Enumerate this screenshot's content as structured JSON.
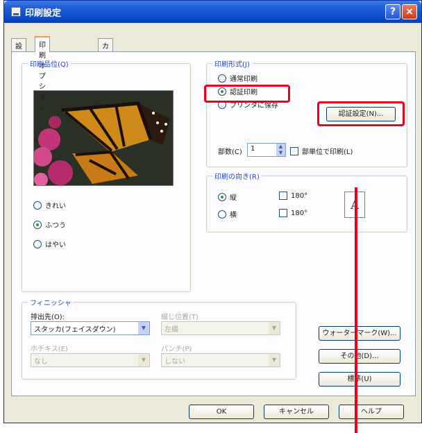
{
  "window": {
    "title": "印刷設定",
    "help_label": "?",
    "close_label": "×"
  },
  "tabs": [
    "設定",
    "印刷オプション",
    "カラー"
  ],
  "print_quality": {
    "label": "印刷品位(Q)",
    "options": [
      {
        "label": "きれい",
        "selected": false
      },
      {
        "label": "ふつう",
        "selected": true
      },
      {
        "label": "はやい",
        "selected": false
      }
    ]
  },
  "print_mode": {
    "label": "印刷形式(J)",
    "options": [
      {
        "label": "通常印刷",
        "selected": false
      },
      {
        "label": "認証印刷",
        "selected": true
      },
      {
        "label": "プリンタに保存",
        "selected": false
      }
    ],
    "auth_settings_button": "認証設定(N)...",
    "copies_label": "部数(C)",
    "copies_value": "1",
    "collate_label": "部単位で印刷(L)",
    "collate_checked": false
  },
  "orientation": {
    "label": "印刷の向き(R)",
    "portrait_label": "縦",
    "landscape_label": "横",
    "rotate_label": "180°",
    "selected": "portrait",
    "preview_glyph": "A"
  },
  "finisher": {
    "label": "フィニッシャ",
    "output_label": "排出先(O):",
    "output_value": "スタッカ(フェイスダウン)",
    "binding_label": "綴じ位置(T)",
    "binding_value": "左綴",
    "staple_label": "ホチキス(E)",
    "staple_value": "なし",
    "punch_label": "パンチ(P)",
    "punch_value": "しない"
  },
  "side_buttons": {
    "watermark": "ウォーターマーク(W)...",
    "other": "その他(D)...",
    "standard": "標準(U)"
  },
  "dialog_buttons": {
    "ok": "OK",
    "cancel": "キャンセル",
    "help": "ヘルプ"
  },
  "colors": {
    "title_bar": "#0a49c8",
    "highlight": "#e8001c"
  }
}
